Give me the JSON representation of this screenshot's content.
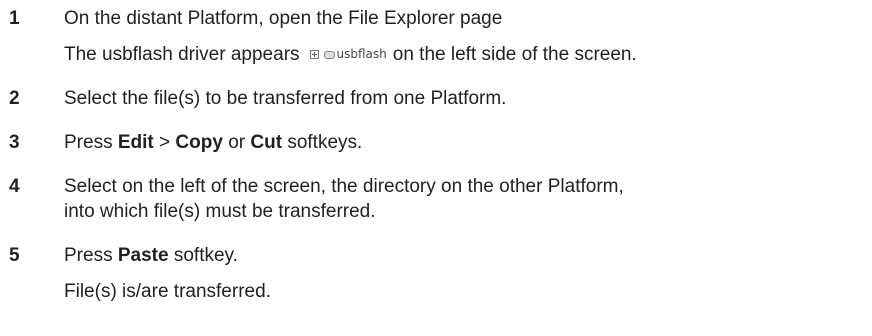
{
  "steps": [
    {
      "number": "1",
      "line1": "On the distant Platform, open the File Explorer page",
      "line2_before": "The usbflash driver appears",
      "usb_label": "usbflash",
      "line2_after": "on the left side of the screen."
    },
    {
      "number": "2",
      "text": "Select the file(s) to be transferred from one Platform."
    },
    {
      "number": "3",
      "press": "Press",
      "edit": "Edit",
      "arrow": ">",
      "copy": "Copy",
      "or": "or",
      "cut": "Cut",
      "softkeys": "softkeys."
    },
    {
      "number": "4",
      "line1": "Select on the left of the screen, the directory on the other Platform,",
      "line2": "into which file(s) must be transferred."
    },
    {
      "number": "5",
      "press": "Press",
      "paste": "Paste",
      "softkey": "softkey.",
      "result": "File(s) is/are transferred."
    }
  ],
  "icons": {
    "expand": "plus-box-icon",
    "drive": "usb-drive-icon"
  }
}
